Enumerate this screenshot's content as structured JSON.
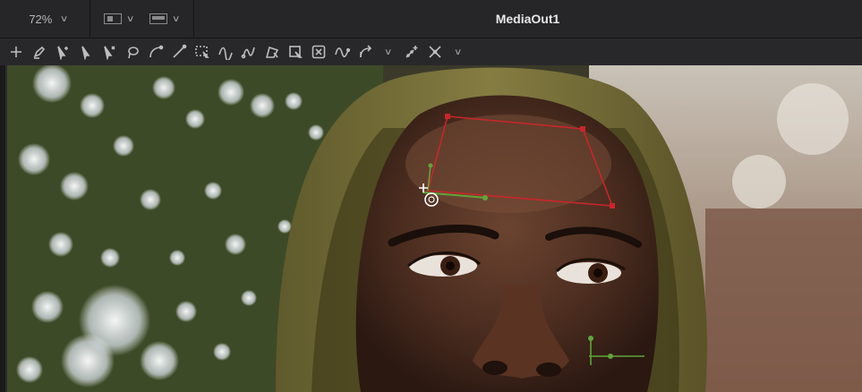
{
  "viewer": {
    "zoom": "72%",
    "title": "MediaOut1"
  },
  "toolbar": {
    "tools": [
      "add-icon",
      "pen-icon",
      "select-add-icon",
      "select-icon",
      "select-remove-icon",
      "lasso-icon",
      "curve-icon",
      "line-icon",
      "rect-select-icon",
      "wave-icon",
      "spline-icon",
      "polygon-select-icon",
      "box-close-icon",
      "bspline-icon",
      "transform-icon",
      "dropdown-icon",
      "points-add-icon",
      "points-remove-icon",
      "more-dropdown-icon"
    ]
  },
  "colors": {
    "mask_outline": "#c8262b",
    "tracker_green": "#5fa63a"
  }
}
